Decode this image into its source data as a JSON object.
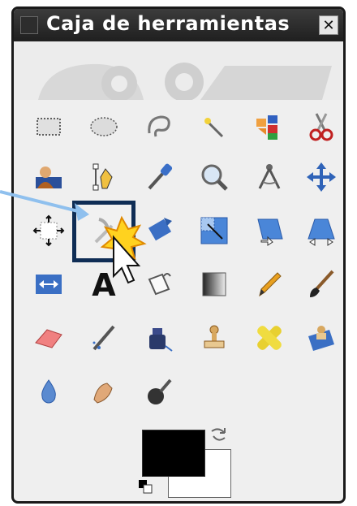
{
  "window": {
    "title": "Caja de herramientas",
    "close_label": "✕"
  },
  "colors": {
    "titlebar": "#1f1f1f",
    "panel": "#efefef",
    "selection_frame": "#0f2d55",
    "foreground": "#000000",
    "background": "#ffffff",
    "annotation": "#7fb3e8"
  },
  "tools": [
    {
      "name": "rect-select-icon"
    },
    {
      "name": "ellipse-select-icon"
    },
    {
      "name": "free-select-icon"
    },
    {
      "name": "fuzzy-select-icon"
    },
    {
      "name": "color-select-icon"
    },
    {
      "name": "scissors-icon"
    },
    {
      "name": "foreground-select-icon"
    },
    {
      "name": "paths-icon"
    },
    {
      "name": "color-picker-icon"
    },
    {
      "name": "zoom-icon"
    },
    {
      "name": "measure-icon"
    },
    {
      "name": "move-icon"
    },
    {
      "name": "align-icon"
    },
    {
      "name": "crop-icon"
    },
    {
      "name": "rotate-icon"
    },
    {
      "name": "scale-icon"
    },
    {
      "name": "shear-icon"
    },
    {
      "name": "perspective-icon"
    },
    {
      "name": "flip-icon"
    },
    {
      "name": "text-icon"
    },
    {
      "name": "bucket-fill-icon"
    },
    {
      "name": "blend-icon"
    },
    {
      "name": "pencil-icon"
    },
    {
      "name": "paintbrush-icon"
    },
    {
      "name": "eraser-icon"
    },
    {
      "name": "airbrush-icon"
    },
    {
      "name": "ink-icon"
    },
    {
      "name": "clone-icon"
    },
    {
      "name": "heal-icon"
    },
    {
      "name": "perspective-clone-icon"
    },
    {
      "name": "blur-icon"
    },
    {
      "name": "smudge-icon"
    },
    {
      "name": "dodge-burn-icon"
    }
  ],
  "glyph_text": "A"
}
